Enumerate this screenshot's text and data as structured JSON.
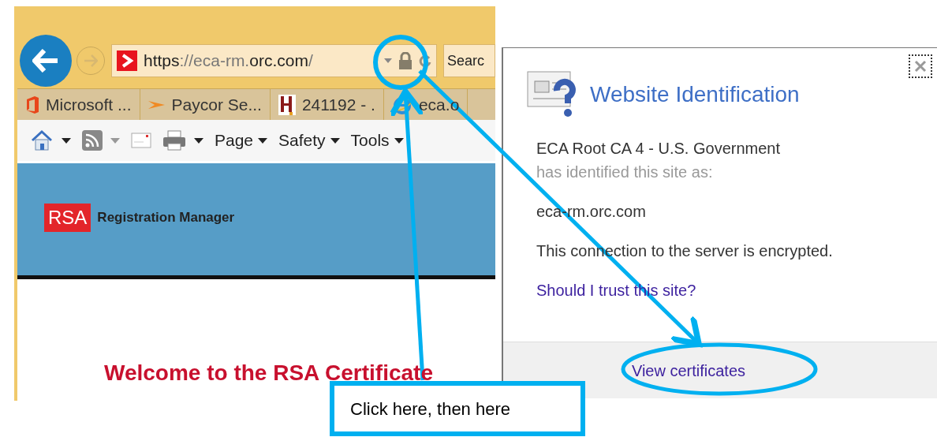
{
  "browser": {
    "url_parts": [
      {
        "text": "https",
        "emphasis": true
      },
      {
        "text": "://eca-rm.",
        "emphasis": false
      },
      {
        "text": "orc.com",
        "emphasis": true
      },
      {
        "text": "/",
        "emphasis": false
      }
    ],
    "search": {
      "placeholder": "Searc"
    },
    "favorites": [
      {
        "kind": "office",
        "label": "Microsoft ..."
      },
      {
        "kind": "paycor",
        "label": "Paycor Se..."
      },
      {
        "kind": "letter",
        "label": "241192 - ."
      },
      {
        "kind": "ie",
        "label": "eca.o"
      }
    ],
    "command_menus": [
      {
        "label": "Page"
      },
      {
        "label": "Safety"
      },
      {
        "label": "Tools"
      }
    ]
  },
  "page": {
    "logo": "RSA",
    "app_name": "Registration Manager",
    "welcome": "Welcome to the RSA Certificate"
  },
  "dialog": {
    "title": "Website Identification",
    "issuer": "ECA Root CA 4 - U.S. Government",
    "issuer_note": "has identified this site as:",
    "site": "eca-rm.orc.com",
    "encryption_note": "This connection to the server is encrypted.",
    "trust_link": "Should I trust this site?",
    "view_button": "View certificates"
  },
  "callout": {
    "text": "Click here, then here"
  }
}
